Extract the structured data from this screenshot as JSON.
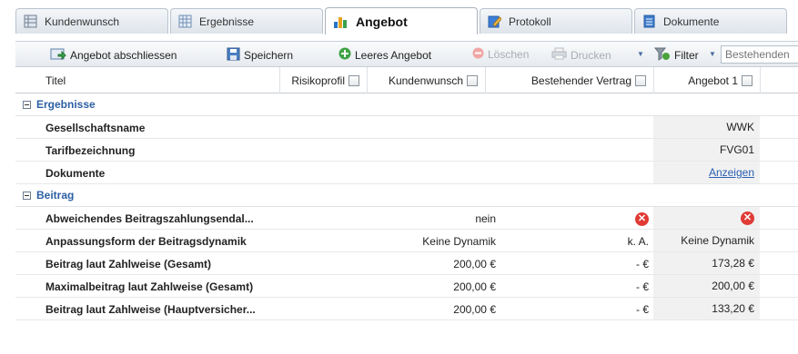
{
  "tabs": [
    {
      "label": "Kundenwunsch",
      "icon": "table-icon",
      "active": false
    },
    {
      "label": "Ergebnisse",
      "icon": "grid-icon",
      "active": false
    },
    {
      "label": "Angebot",
      "icon": "bar-chart-icon",
      "active": true
    },
    {
      "label": "Protokoll",
      "icon": "edit-document-icon",
      "active": false
    },
    {
      "label": "Dokumente",
      "icon": "document-icon",
      "active": false
    }
  ],
  "toolbar": {
    "finish_label": "Angebot abschliessen",
    "save_label": "Speichern",
    "empty_offer_label": "Leeres Angebot",
    "delete_label": "Löschen",
    "print_label": "Drucken",
    "filter_label": "Filter",
    "search_placeholder": "Bestehenden"
  },
  "columns": {
    "title": "Titel",
    "risk": "Risikoprofil",
    "customer": "Kundenwunsch",
    "contract": "Bestehender Vertrag",
    "offer": "Angebot 1"
  },
  "groups": [
    {
      "title": "Ergebnisse",
      "rows": [
        {
          "label": "Gesellschaftsname",
          "v1": "",
          "v2": "",
          "v3": "WWK"
        },
        {
          "label": "Tarifbezeichnung",
          "v1": "",
          "v2": "",
          "v3": "FVG01"
        },
        {
          "label": "Dokumente",
          "v1": "",
          "v2": "",
          "v3": "Anzeigen",
          "v3_link": true
        }
      ]
    },
    {
      "title": "Beitrag",
      "rows": [
        {
          "label": "Abweichendes Beitragszahlungsendal...",
          "v1": "nein",
          "v2": "x-icon",
          "v3": "x-icon"
        },
        {
          "label": "Anpassungsform der Beitragsdynamik",
          "v1": "Keine Dynamik",
          "v2": "k. A.",
          "v3": "Keine Dynamik"
        },
        {
          "label": "Beitrag laut Zahlweise (Gesamt)",
          "v1": "200,00 €",
          "v2": "- €",
          "v3": "173,28 €"
        },
        {
          "label": "Maximalbeitrag laut Zahlweise (Gesamt)",
          "v1": "200,00 €",
          "v2": "- €",
          "v3": "200,00 €"
        },
        {
          "label": "Beitrag laut Zahlweise (Hauptversicher...",
          "v1": "200,00 €",
          "v2": "- €",
          "v3": "133,20 €"
        }
      ]
    }
  ],
  "colors": {
    "accent": "#2c5fa3",
    "error": "#e03b36",
    "link": "#2b5fb1"
  }
}
